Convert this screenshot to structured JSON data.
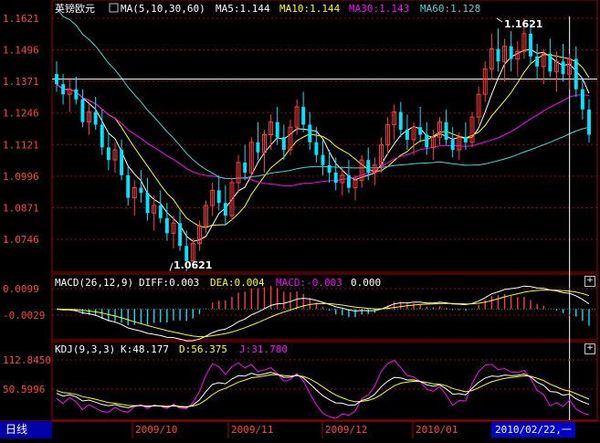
{
  "instrument": "英镑欧元",
  "period_tab": "日线",
  "cursor_date": "2010/02/22,一",
  "main": {
    "indicator_label": "MA(5,10,30,60)",
    "ma5_text": "MA5:1.144",
    "ma10_text": "MA10:1.144",
    "ma30_text": "MA30:1.143",
    "ma60_text": "MA60:1.128",
    "price_ticks": [
      "1.1621",
      "1.1496",
      "1.1371",
      "1.1246",
      "1.1121",
      "1.0996",
      "1.0871",
      "1.0746"
    ],
    "price_tick_values": [
      1.1621,
      1.1496,
      1.1371,
      1.1246,
      1.1121,
      1.0996,
      1.0871,
      1.0746
    ],
    "high_marker": "1.1621",
    "low_marker": "1.0621",
    "high_value": 1.1621,
    "low_value": 1.0621
  },
  "macd": {
    "title": "MACD(26,12,9)",
    "diff_text": "DIFF:0.003",
    "dea_text": "DEA:0.004",
    "macd_text": "MACD:-0.003",
    "extra_text": "0.000",
    "ticks": [
      "0.0099",
      "-0.0029"
    ],
    "tick_values": [
      0.0099,
      -0.0029
    ]
  },
  "kdj": {
    "title": "KDJ(9,3,3)",
    "k_text": "K:48.177",
    "d_text": "D:56.375",
    "j_text": "J:31.780",
    "ticks": [
      "112.8450",
      "50.5996"
    ],
    "tick_values": [
      112.845,
      50.5996
    ]
  },
  "months": [
    "2009/10",
    "2009/11",
    "2009/12",
    "2010/01"
  ],
  "colors": {
    "up": "#ff3c3c",
    "down": "#00e4ff",
    "ma5": "#ffffff",
    "ma10": "#ffff00",
    "ma30": "#ff00ff",
    "ma60": "#00ff00",
    "ma60_line": "#40d8d8",
    "grid": "#a00000",
    "axis_text": "#ff4040"
  },
  "chart_data": {
    "type": "candlestick",
    "candles": [
      {
        "o": 1.14,
        "h": 1.145,
        "l": 1.133,
        "c": 1.136
      },
      {
        "o": 1.136,
        "h": 1.14,
        "l": 1.128,
        "c": 1.132
      },
      {
        "o": 1.132,
        "h": 1.138,
        "l": 1.125,
        "c": 1.134
      },
      {
        "o": 1.134,
        "h": 1.139,
        "l": 1.128,
        "c": 1.13
      },
      {
        "o": 1.13,
        "h": 1.134,
        "l": 1.119,
        "c": 1.121
      },
      {
        "o": 1.121,
        "h": 1.128,
        "l": 1.116,
        "c": 1.125
      },
      {
        "o": 1.125,
        "h": 1.131,
        "l": 1.118,
        "c": 1.12
      },
      {
        "o": 1.12,
        "h": 1.126,
        "l": 1.108,
        "c": 1.111
      },
      {
        "o": 1.111,
        "h": 1.117,
        "l": 1.102,
        "c": 1.106
      },
      {
        "o": 1.106,
        "h": 1.113,
        "l": 1.101,
        "c": 1.11
      },
      {
        "o": 1.11,
        "h": 1.114,
        "l": 1.098,
        "c": 1.1
      },
      {
        "o": 1.1,
        "h": 1.104,
        "l": 1.088,
        "c": 1.091
      },
      {
        "o": 1.091,
        "h": 1.098,
        "l": 1.084,
        "c": 1.095
      },
      {
        "o": 1.095,
        "h": 1.102,
        "l": 1.089,
        "c": 1.093
      },
      {
        "o": 1.093,
        "h": 1.099,
        "l": 1.082,
        "c": 1.085
      },
      {
        "o": 1.085,
        "h": 1.092,
        "l": 1.078,
        "c": 1.088
      },
      {
        "o": 1.088,
        "h": 1.094,
        "l": 1.081,
        "c": 1.083
      },
      {
        "o": 1.083,
        "h": 1.089,
        "l": 1.074,
        "c": 1.077
      },
      {
        "o": 1.077,
        "h": 1.084,
        "l": 1.071,
        "c": 1.081
      },
      {
        "o": 1.081,
        "h": 1.086,
        "l": 1.07,
        "c": 1.072
      },
      {
        "o": 1.072,
        "h": 1.078,
        "l": 1.062,
        "c": 1.066
      },
      {
        "o": 1.066,
        "h": 1.075,
        "l": 1.064,
        "c": 1.073
      },
      {
        "o": 1.073,
        "h": 1.082,
        "l": 1.07,
        "c": 1.08
      },
      {
        "o": 1.08,
        "h": 1.09,
        "l": 1.077,
        "c": 1.088
      },
      {
        "o": 1.088,
        "h": 1.097,
        "l": 1.084,
        "c": 1.094
      },
      {
        "o": 1.094,
        "h": 1.1,
        "l": 1.086,
        "c": 1.089
      },
      {
        "o": 1.089,
        "h": 1.096,
        "l": 1.08,
        "c": 1.084
      },
      {
        "o": 1.084,
        "h": 1.099,
        "l": 1.082,
        "c": 1.097
      },
      {
        "o": 1.097,
        "h": 1.108,
        "l": 1.093,
        "c": 1.105
      },
      {
        "o": 1.105,
        "h": 1.112,
        "l": 1.098,
        "c": 1.101
      },
      {
        "o": 1.101,
        "h": 1.115,
        "l": 1.099,
        "c": 1.113
      },
      {
        "o": 1.113,
        "h": 1.121,
        "l": 1.106,
        "c": 1.109
      },
      {
        "o": 1.109,
        "h": 1.118,
        "l": 1.101,
        "c": 1.116
      },
      {
        "o": 1.116,
        "h": 1.124,
        "l": 1.11,
        "c": 1.121
      },
      {
        "o": 1.121,
        "h": 1.127,
        "l": 1.112,
        "c": 1.115
      },
      {
        "o": 1.115,
        "h": 1.12,
        "l": 1.106,
        "c": 1.11
      },
      {
        "o": 1.11,
        "h": 1.122,
        "l": 1.108,
        "c": 1.119
      },
      {
        "o": 1.119,
        "h": 1.13,
        "l": 1.116,
        "c": 1.127
      },
      {
        "o": 1.127,
        "h": 1.133,
        "l": 1.117,
        "c": 1.12
      },
      {
        "o": 1.12,
        "h": 1.125,
        "l": 1.11,
        "c": 1.113
      },
      {
        "o": 1.113,
        "h": 1.119,
        "l": 1.105,
        "c": 1.108
      },
      {
        "o": 1.108,
        "h": 1.114,
        "l": 1.1,
        "c": 1.104
      },
      {
        "o": 1.104,
        "h": 1.11,
        "l": 1.097,
        "c": 1.101
      },
      {
        "o": 1.101,
        "h": 1.107,
        "l": 1.094,
        "c": 1.097
      },
      {
        "o": 1.097,
        "h": 1.103,
        "l": 1.092,
        "c": 1.1
      },
      {
        "o": 1.1,
        "h": 1.106,
        "l": 1.093,
        "c": 1.095
      },
      {
        "o": 1.095,
        "h": 1.1,
        "l": 1.09,
        "c": 1.098
      },
      {
        "o": 1.098,
        "h": 1.108,
        "l": 1.095,
        "c": 1.106
      },
      {
        "o": 1.106,
        "h": 1.111,
        "l": 1.098,
        "c": 1.101
      },
      {
        "o": 1.101,
        "h": 1.107,
        "l": 1.096,
        "c": 1.104
      },
      {
        "o": 1.104,
        "h": 1.115,
        "l": 1.101,
        "c": 1.112
      },
      {
        "o": 1.112,
        "h": 1.123,
        "l": 1.108,
        "c": 1.12
      },
      {
        "o": 1.12,
        "h": 1.128,
        "l": 1.114,
        "c": 1.125
      },
      {
        "o": 1.125,
        "h": 1.129,
        "l": 1.115,
        "c": 1.118
      },
      {
        "o": 1.118,
        "h": 1.124,
        "l": 1.11,
        "c": 1.114
      },
      {
        "o": 1.114,
        "h": 1.121,
        "l": 1.108,
        "c": 1.119
      },
      {
        "o": 1.119,
        "h": 1.127,
        "l": 1.113,
        "c": 1.116
      },
      {
        "o": 1.116,
        "h": 1.121,
        "l": 1.108,
        "c": 1.111
      },
      {
        "o": 1.111,
        "h": 1.118,
        "l": 1.106,
        "c": 1.115
      },
      {
        "o": 1.115,
        "h": 1.123,
        "l": 1.112,
        "c": 1.121
      },
      {
        "o": 1.121,
        "h": 1.126,
        "l": 1.112,
        "c": 1.114
      },
      {
        "o": 1.114,
        "h": 1.119,
        "l": 1.107,
        "c": 1.11
      },
      {
        "o": 1.11,
        "h": 1.117,
        "l": 1.106,
        "c": 1.115
      },
      {
        "o": 1.115,
        "h": 1.121,
        "l": 1.11,
        "c": 1.113
      },
      {
        "o": 1.113,
        "h": 1.125,
        "l": 1.111,
        "c": 1.123
      },
      {
        "o": 1.123,
        "h": 1.135,
        "l": 1.12,
        "c": 1.132
      },
      {
        "o": 1.132,
        "h": 1.145,
        "l": 1.129,
        "c": 1.142
      },
      {
        "o": 1.142,
        "h": 1.156,
        "l": 1.138,
        "c": 1.15
      },
      {
        "o": 1.15,
        "h": 1.158,
        "l": 1.141,
        "c": 1.145
      },
      {
        "o": 1.145,
        "h": 1.154,
        "l": 1.137,
        "c": 1.151
      },
      {
        "o": 1.151,
        "h": 1.157,
        "l": 1.141,
        "c": 1.146
      },
      {
        "o": 1.146,
        "h": 1.153,
        "l": 1.139,
        "c": 1.149
      },
      {
        "o": 1.149,
        "h": 1.162,
        "l": 1.146,
        "c": 1.156
      },
      {
        "o": 1.156,
        "h": 1.16,
        "l": 1.144,
        "c": 1.147
      },
      {
        "o": 1.147,
        "h": 1.152,
        "l": 1.138,
        "c": 1.143
      },
      {
        "o": 1.143,
        "h": 1.15,
        "l": 1.136,
        "c": 1.148
      },
      {
        "o": 1.148,
        "h": 1.154,
        "l": 1.139,
        "c": 1.141
      },
      {
        "o": 1.141,
        "h": 1.149,
        "l": 1.133,
        "c": 1.145
      },
      {
        "o": 1.145,
        "h": 1.152,
        "l": 1.137,
        "c": 1.14
      },
      {
        "o": 1.14,
        "h": 1.148,
        "l": 1.134,
        "c": 1.146
      },
      {
        "o": 1.146,
        "h": 1.151,
        "l": 1.131,
        "c": 1.134
      },
      {
        "o": 1.134,
        "h": 1.138,
        "l": 1.122,
        "c": 1.126
      },
      {
        "o": 1.126,
        "h": 1.13,
        "l": 1.113,
        "c": 1.116
      }
    ]
  }
}
